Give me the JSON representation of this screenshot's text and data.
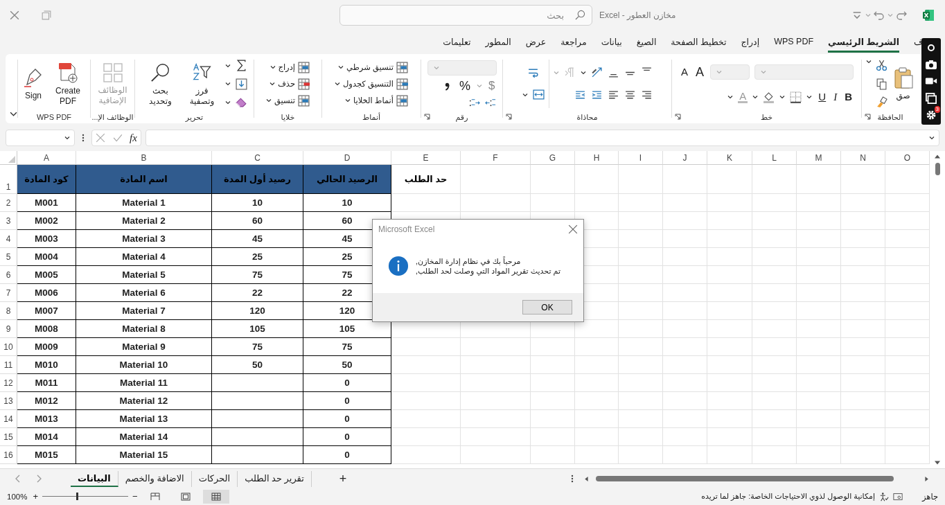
{
  "window": {
    "title": "مخازن العطور - Excel",
    "search": {
      "placeholder": "بحث"
    }
  },
  "ribbon_tabs": [
    {
      "label": "ف",
      "selected": false
    },
    {
      "label": "الشريط الرئيسي",
      "selected": true
    },
    {
      "label": "WPS PDF",
      "selected": false
    },
    {
      "label": "إدراج",
      "selected": false
    },
    {
      "label": "تخطيط الصفحة",
      "selected": false
    },
    {
      "label": "الصيغ",
      "selected": false
    },
    {
      "label": "بيانات",
      "selected": false
    },
    {
      "label": "مراجعة",
      "selected": false
    },
    {
      "label": "عرض",
      "selected": false
    },
    {
      "label": "المطور",
      "selected": false
    },
    {
      "label": "تعليمات",
      "selected": false
    }
  ],
  "side_toolbar": {
    "badge": "3"
  },
  "ribbon_groups": [
    {
      "kind": "clipboard",
      "name": "الحافظة",
      "launcher": true,
      "paste_label": "صق"
    },
    {
      "kind": "font",
      "name": "خط",
      "launcher": true,
      "grow": "A",
      "shrink": "A",
      "bold": "B",
      "italic": "I",
      "underline": "U",
      "font_color": "A"
    },
    {
      "kind": "alignment",
      "name": "محاذاة",
      "launcher": true
    },
    {
      "kind": "number",
      "name": "رقم",
      "launcher": true,
      "currency": "$",
      "percent": "%"
    },
    {
      "kind": "styles",
      "name": "أنماط",
      "items": [
        {
          "label": "تنسيق شرطي"
        },
        {
          "label": "التنسيق كجدول"
        },
        {
          "label": "أنماط الخلايا"
        }
      ]
    },
    {
      "kind": "cells",
      "name": "خلايا",
      "items": [
        {
          "label": "إدراج"
        },
        {
          "label": "حذف"
        },
        {
          "label": "تنسيق"
        }
      ]
    },
    {
      "kind": "editing",
      "name": "تحرير",
      "items": [
        {
          "label": "فرز وتصفية"
        },
        {
          "label": "بحث وتحديد"
        }
      ]
    },
    {
      "kind": "addins",
      "name": "الوظائف الإ...",
      "items": [
        {
          "label": "الوظائف الإضافية",
          "disabled": true
        }
      ]
    },
    {
      "kind": "pdf",
      "name": "WPS PDF",
      "items": [
        {
          "label": "Create PDF"
        },
        {
          "label": "Sign"
        }
      ]
    }
  ],
  "formula_bar": {
    "function_label": "fx"
  },
  "sheet": {
    "columns": [
      "O",
      "N",
      "M",
      "L",
      "K",
      "J",
      "I",
      "H",
      "G",
      "F",
      "E",
      "D",
      "C",
      "B",
      "A"
    ],
    "header_row": {
      "number": "1",
      "cells": [
        {
          "text": "حد الطلب",
          "filled": false
        },
        {
          "text": "الرصيد الحالي",
          "filled": true
        },
        {
          "text": "رصيد أول المدة",
          "filled": true
        },
        {
          "text": "اسم المادة",
          "filled": true
        },
        {
          "text": "كود المادة",
          "filled": true
        }
      ]
    },
    "rows": [
      {
        "number": "2",
        "code": "M001",
        "name": "Material 1",
        "opening": "10",
        "current": "10"
      },
      {
        "number": "3",
        "code": "M002",
        "name": "Material 2",
        "opening": "60",
        "current": "60"
      },
      {
        "number": "4",
        "code": "M003",
        "name": "Material 3",
        "opening": "45",
        "current": "45"
      },
      {
        "number": "5",
        "code": "M004",
        "name": "Material 4",
        "opening": "25",
        "current": "25"
      },
      {
        "number": "6",
        "code": "M005",
        "name": "Material 5",
        "opening": "75",
        "current": "75"
      },
      {
        "number": "7",
        "code": "M006",
        "name": "Material 6",
        "opening": "22",
        "current": "22"
      },
      {
        "number": "8",
        "code": "M007",
        "name": "Material 7",
        "opening": "120",
        "current": "120"
      },
      {
        "number": "9",
        "code": "M008",
        "name": "Material 8",
        "opening": "105",
        "current": "105"
      },
      {
        "number": "10",
        "code": "M009",
        "name": "Material 9",
        "opening": "75",
        "current": "75"
      },
      {
        "number": "11",
        "code": "M010",
        "name": "Material 10",
        "opening": "50",
        "current": "50"
      },
      {
        "number": "12",
        "code": "M011",
        "name": "Material 11",
        "current": "0"
      },
      {
        "number": "13",
        "code": "M012",
        "name": "Material 12",
        "current": "0"
      },
      {
        "number": "14",
        "code": "M013",
        "name": "Material 13",
        "current": "0"
      },
      {
        "number": "15",
        "code": "M014",
        "name": "Material 14",
        "current": "0"
      },
      {
        "number": "16",
        "code": "M015",
        "name": "Material 15",
        "current": "0"
      }
    ]
  },
  "dialog": {
    "title": "Microsoft Excel",
    "message_lines": [
      "مرحباً بك في نظام إدارة المخازن,",
      "تم تحديث تقرير المواد التي وصلت لحد الطلب,"
    ],
    "button": "OK"
  },
  "sheet_tabs": {
    "tabs": [
      {
        "label": "تقرير حد الطلب",
        "selected": false
      },
      {
        "label": "الحركات",
        "selected": false
      },
      {
        "label": "الاضافة والخصم",
        "selected": false
      },
      {
        "label": "البيانات",
        "selected": true
      }
    ],
    "add_label": "+"
  },
  "status_bar": {
    "zoom": {
      "reading": "100%",
      "zoom_in": "+",
      "zoom_out": "−",
      "level": 0.4
    },
    "views": [
      {
        "kind": "normal",
        "selected": true
      },
      {
        "kind": "page_layout",
        "selected": false
      },
      {
        "kind": "page_break",
        "selected": false
      }
    ],
    "accessibility": "إمكانية الوصول لذوي الاحتياجات الخاصة: جاهز لما تريده",
    "status": "جاهز"
  }
}
